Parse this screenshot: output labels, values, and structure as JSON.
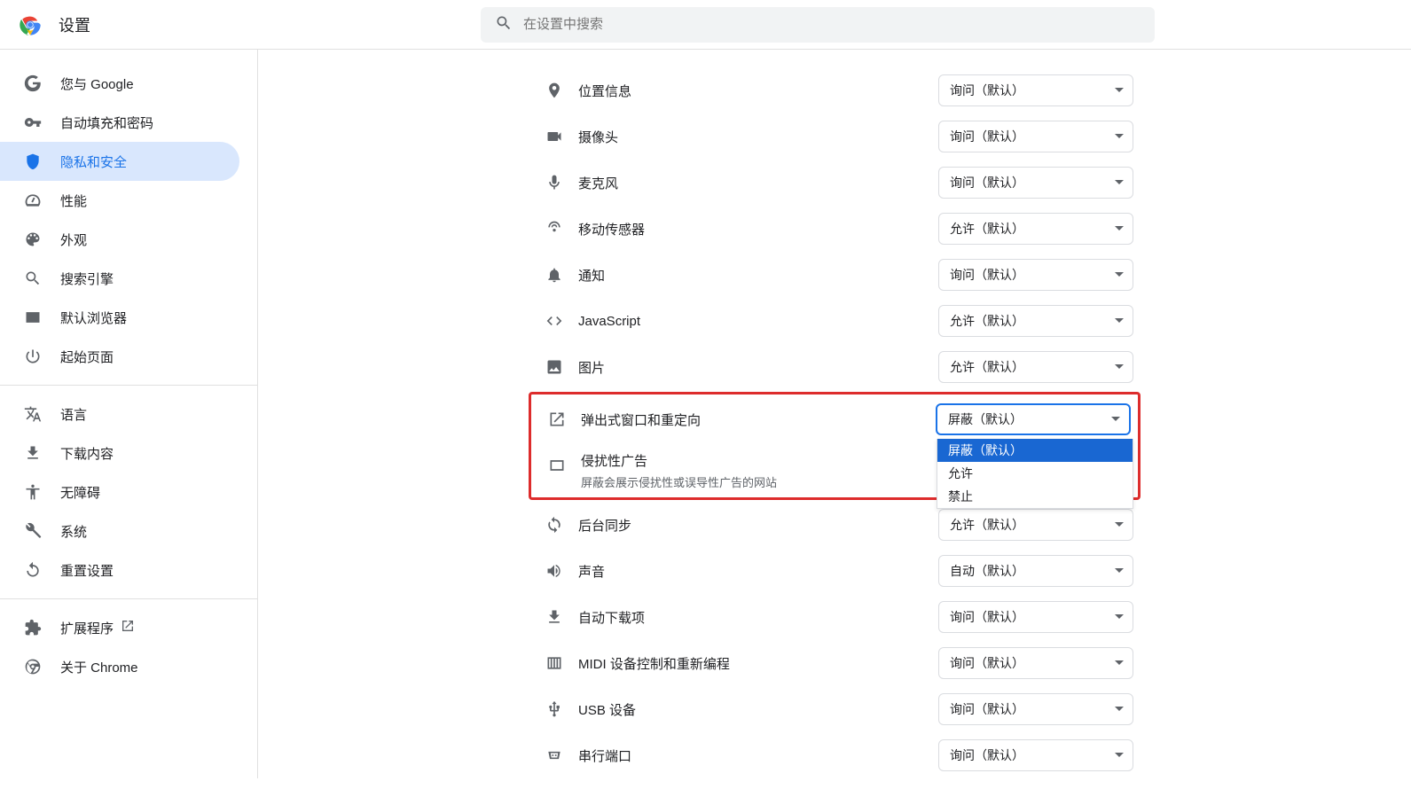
{
  "header": {
    "title": "设置",
    "search_placeholder": "在设置中搜索"
  },
  "sidebar": {
    "items": [
      {
        "label": "您与 Google"
      },
      {
        "label": "自动填充和密码"
      },
      {
        "label": "隐私和安全"
      },
      {
        "label": "性能"
      },
      {
        "label": "外观"
      },
      {
        "label": "搜索引擎"
      },
      {
        "label": "默认浏览器"
      },
      {
        "label": "起始页面"
      }
    ],
    "items2": [
      {
        "label": "语言"
      },
      {
        "label": "下载内容"
      },
      {
        "label": "无障碍"
      },
      {
        "label": "系统"
      },
      {
        "label": "重置设置"
      }
    ],
    "items3": [
      {
        "label": "扩展程序"
      },
      {
        "label": "关于 Chrome"
      }
    ]
  },
  "permissions": [
    {
      "label": "位置信息",
      "value": "询问（默认）"
    },
    {
      "label": "摄像头",
      "value": "询问（默认）"
    },
    {
      "label": "麦克风",
      "value": "询问（默认）"
    },
    {
      "label": "移动传感器",
      "value": "允许（默认）"
    },
    {
      "label": "通知",
      "value": "询问（默认）"
    },
    {
      "label": "JavaScript",
      "value": "允许（默认）"
    },
    {
      "label": "图片",
      "value": "允许（默认）"
    },
    {
      "label": "弹出式窗口和重定向",
      "value": "屏蔽（默认）"
    },
    {
      "label": "侵扰性广告",
      "sub": "屏蔽会展示侵扰性或误导性广告的网站"
    },
    {
      "label": "后台同步",
      "value": "允许（默认）"
    },
    {
      "label": "声音",
      "value": "自动（默认）"
    },
    {
      "label": "自动下载项",
      "value": "询问（默认）"
    },
    {
      "label": "MIDI 设备控制和重新编程",
      "value": "询问（默认）"
    },
    {
      "label": "USB 设备",
      "value": "询问（默认）"
    },
    {
      "label": "串行端口",
      "value": "询问（默认）"
    }
  ],
  "dropdown": {
    "options": [
      "屏蔽（默认）",
      "允许",
      "禁止"
    ],
    "selected": "屏蔽（默认）"
  }
}
